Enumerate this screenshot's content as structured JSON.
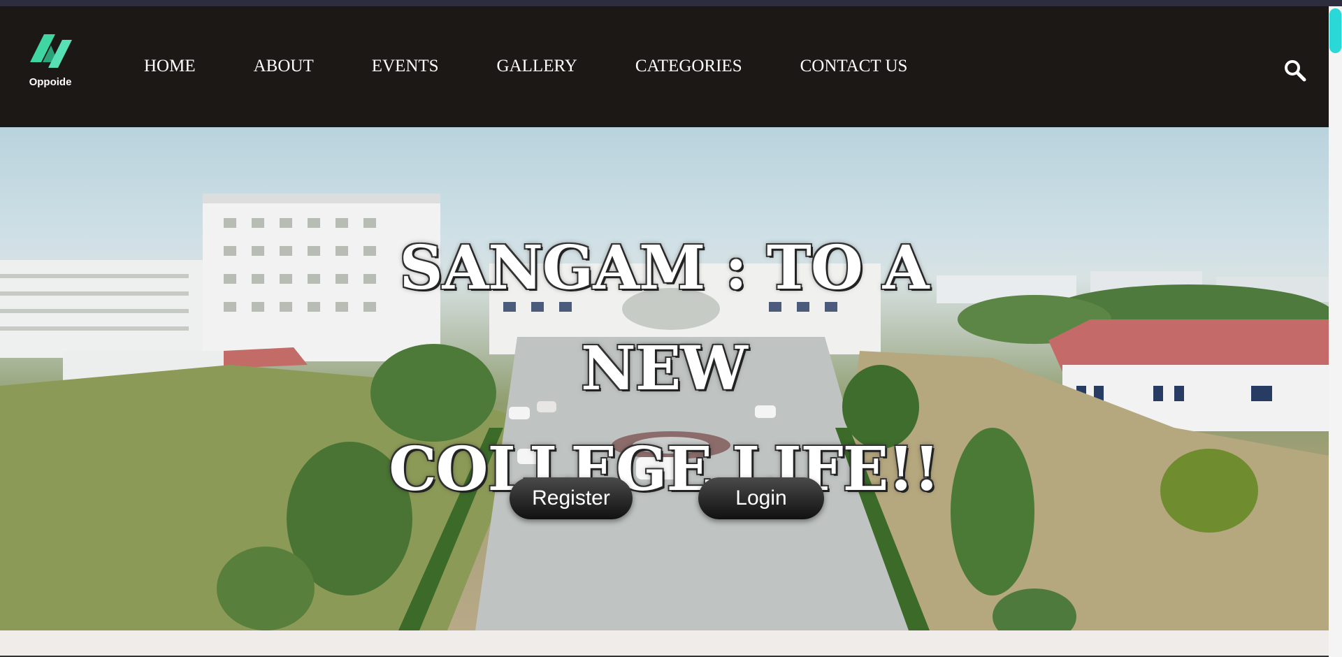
{
  "brand": {
    "name": "Oppoide",
    "logo_icon": "oppoide-logo-icon",
    "logo_colors": [
      "#3fd6a4",
      "#2aa37a"
    ]
  },
  "nav": {
    "items": [
      {
        "label": "HOME"
      },
      {
        "label": "ABOUT"
      },
      {
        "label": "EVENTS"
      },
      {
        "label": "GALLERY"
      },
      {
        "label": "CATEGORIES"
      },
      {
        "label": "CONTACT US"
      }
    ],
    "search_icon": "search-icon"
  },
  "hero": {
    "title_line1": "SANGAM : TO A NEW",
    "title_line2": "COLLEGE LIFE!!",
    "register_label": "Register",
    "login_label": "Login",
    "background": "college-campus-aerial-photo"
  },
  "colors": {
    "navbar_bg": "#1b1816",
    "scroll_thumb": "#2ad8d8",
    "page_bg": "#efecea"
  }
}
